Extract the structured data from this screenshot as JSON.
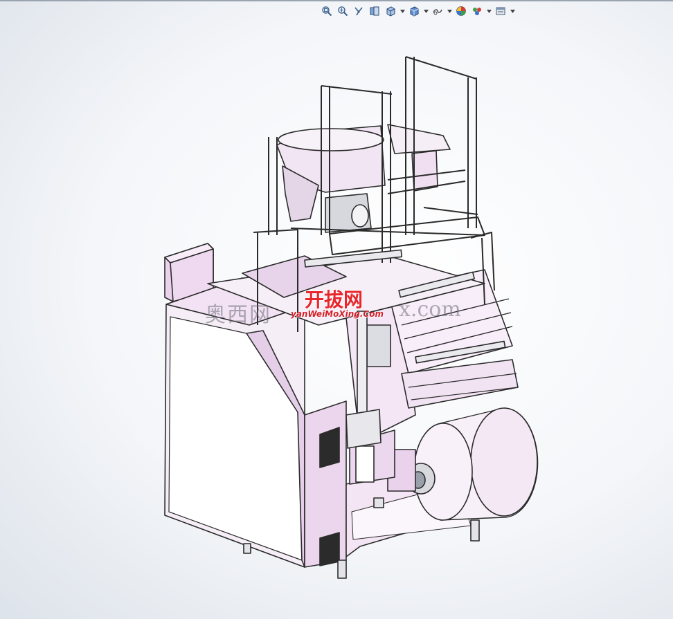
{
  "toolbar": {
    "tools": [
      {
        "name": "zoom-to-fit-icon"
      },
      {
        "name": "zoom-to-area-icon"
      },
      {
        "name": "previous-view-icon"
      },
      {
        "name": "section-view-icon"
      },
      {
        "name": "view-orientation-icon",
        "dropdown": true
      },
      {
        "name": "display-style-icon",
        "dropdown": true
      },
      {
        "name": "hide-show-items-icon",
        "dropdown": true
      },
      {
        "name": "edit-appearance-icon"
      },
      {
        "name": "apply-scene-icon",
        "dropdown": true
      },
      {
        "name": "view-settings-icon",
        "dropdown": true
      }
    ]
  },
  "model": {
    "colors": {
      "body": "#f1dff2",
      "body_shadow": "#dcc4de",
      "edge": "#2a2a2a",
      "metal": "#c9ccd4",
      "window": "#ffffff"
    }
  },
  "watermarks": {
    "cn_left": "奥西网",
    "brand": "开拔网",
    "url": "yanWeiMoXing.Com",
    "domain": "x.com"
  }
}
